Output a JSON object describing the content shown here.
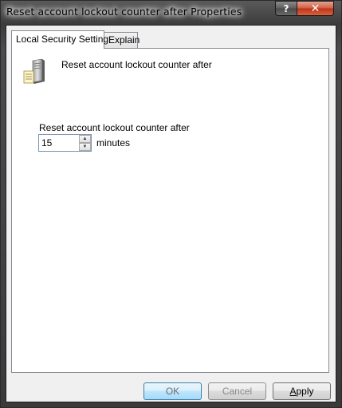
{
  "window": {
    "title": "Reset account lockout counter after Properties"
  },
  "caption_buttons": {
    "help": "?",
    "close": "✕"
  },
  "tabs": [
    {
      "label": "Local Security Setting",
      "selected": true
    },
    {
      "label": "Explain",
      "selected": false
    }
  ],
  "panel": {
    "heading": "Reset account lockout counter after",
    "icon": "server-icon",
    "field_label": "Reset account lockout counter after",
    "value": "15",
    "unit": "minutes"
  },
  "buttons": {
    "ok": "OK",
    "cancel": "Cancel",
    "apply_first": "A",
    "apply_rest": "pply"
  }
}
